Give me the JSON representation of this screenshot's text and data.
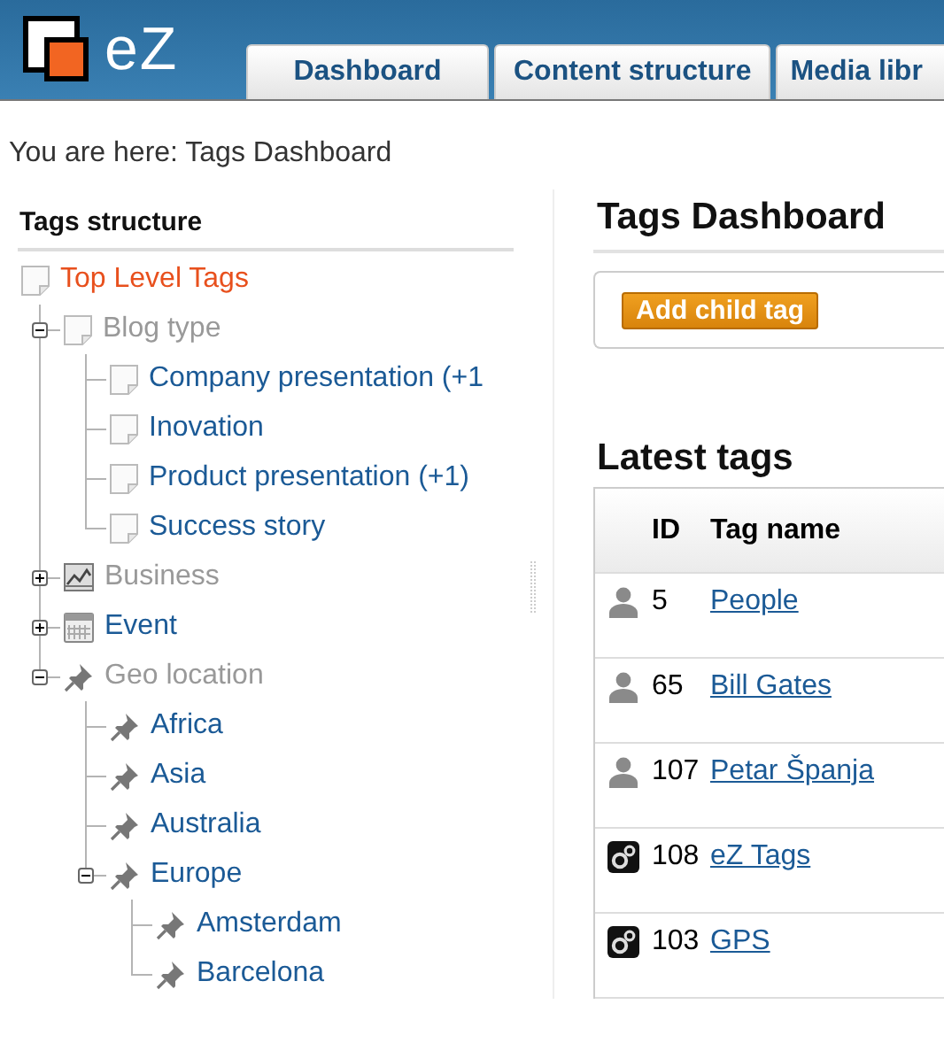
{
  "header": {
    "logo_text": "eZ",
    "tabs": [
      {
        "label": "Dashboard",
        "selected": false
      },
      {
        "label": "Content structure",
        "selected": false
      },
      {
        "label": "Media libr",
        "selected": false
      }
    ]
  },
  "breadcrumb": "You are here: Tags Dashboard",
  "sidebar": {
    "title": "Tags structure",
    "tree": [
      {
        "label": "Top Level Tags",
        "kind": "page",
        "selected": true,
        "dimmed": false,
        "children": [
          {
            "label": "Blog type",
            "kind": "page",
            "selected": false,
            "dimmed": true,
            "expanded": true,
            "children": [
              {
                "label": "Company presentation (+1",
                "kind": "page",
                "selected": false,
                "dimmed": false
              },
              {
                "label": "Inovation",
                "kind": "page",
                "selected": false,
                "dimmed": false
              },
              {
                "label": "Product presentation (+1)",
                "kind": "page",
                "selected": false,
                "dimmed": false
              },
              {
                "label": "Success story",
                "kind": "page",
                "selected": false,
                "dimmed": false
              }
            ]
          },
          {
            "label": "Business",
            "kind": "chart",
            "selected": false,
            "dimmed": true,
            "expanded": false
          },
          {
            "label": "Event",
            "kind": "calendar",
            "selected": false,
            "dimmed": false,
            "expanded": false
          },
          {
            "label": "Geo location",
            "kind": "pin",
            "selected": false,
            "dimmed": true,
            "expanded": true,
            "children": [
              {
                "label": "Africa",
                "kind": "pin",
                "selected": false,
                "dimmed": false
              },
              {
                "label": "Asia",
                "kind": "pin",
                "selected": false,
                "dimmed": false
              },
              {
                "label": "Australia",
                "kind": "pin",
                "selected": false,
                "dimmed": false
              },
              {
                "label": "Europe",
                "kind": "pin",
                "selected": false,
                "dimmed": false,
                "expanded": true,
                "children": [
                  {
                    "label": "Amsterdam",
                    "kind": "pin",
                    "selected": false,
                    "dimmed": false
                  },
                  {
                    "label": "Barcelona",
                    "kind": "pin",
                    "selected": false,
                    "dimmed": false
                  }
                ]
              }
            ]
          }
        ]
      }
    ]
  },
  "main": {
    "title": "Tags Dashboard",
    "add_button": "Add child tag",
    "latest_title": "Latest tags",
    "table": {
      "columns": [
        "ID",
        "Tag name"
      ],
      "rows": [
        {
          "kind": "person",
          "id": "5",
          "name": "People"
        },
        {
          "kind": "person",
          "id": "65",
          "name": "Bill Gates"
        },
        {
          "kind": "person",
          "id": "107",
          "name": "Petar Španja"
        },
        {
          "kind": "gears",
          "id": "108",
          "name": "eZ Tags"
        },
        {
          "kind": "gears",
          "id": "103",
          "name": "GPS"
        }
      ]
    }
  }
}
